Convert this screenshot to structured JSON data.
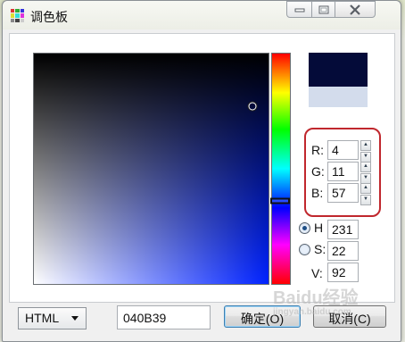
{
  "window": {
    "title": "调色板",
    "icon": "palette-grid-icon",
    "caption_buttons": [
      "minimize-icon",
      "maximize-icon",
      "close-icon"
    ]
  },
  "picker": {
    "current_color_hex": "#040B39",
    "previous_color_hex": "#D3DCEC",
    "hue_plane_color": "#0022FF",
    "sv_cursor": {
      "saturation_pct": 93,
      "value_pct": 77
    },
    "hue_fraction": 0.64
  },
  "rgb": {
    "r_label": "R:",
    "r_value": "4",
    "g_label": "G:",
    "g_value": "11",
    "b_label": "B:",
    "b_value": "57",
    "highlight_color": "#C0272D"
  },
  "hsv": {
    "h_label": "H",
    "h_value": "231",
    "s_label": "S:",
    "s_value": "22",
    "v_label": "V:",
    "v_value": "92",
    "selected_mode": "H"
  },
  "bottom": {
    "format_select": "HTML",
    "hex_value": "040B39",
    "ok_label": "确定(O)",
    "cancel_label": "取消(C)"
  },
  "watermark": {
    "text": "Baidu经验",
    "url": "jingyan.baidu.com"
  }
}
